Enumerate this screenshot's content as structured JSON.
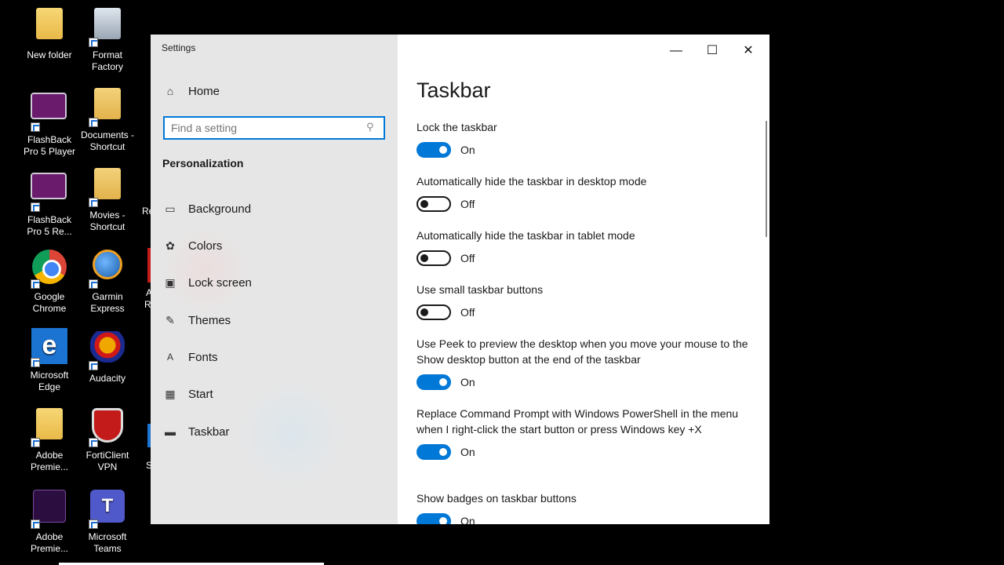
{
  "desktop": {
    "icons": [
      {
        "label1": "New folder",
        "label2": ""
      },
      {
        "label1": "Format",
        "label2": "Factory"
      },
      {
        "label1": "FlashBack",
        "label2": "Pro 5 Player"
      },
      {
        "label1": "Documents -",
        "label2": "Shortcut"
      },
      {
        "label1": "FlashBack",
        "label2": "Pro 5 Re..."
      },
      {
        "label1": "Movies -",
        "label2": "Shortcut"
      },
      {
        "label1": "Google",
        "label2": "Chrome"
      },
      {
        "label1": "Garmin",
        "label2": "Express"
      },
      {
        "label1": "Microsoft",
        "label2": "Edge"
      },
      {
        "label1": "Audacity",
        "label2": ""
      },
      {
        "label1": "Adobe",
        "label2": "Premie..."
      },
      {
        "label1": "FortiClient",
        "label2": "VPN"
      },
      {
        "label1": "Adobe",
        "label2": "Premie..."
      },
      {
        "label1": "Microsoft",
        "label2": "Teams"
      }
    ],
    "partial_labels": [
      "Re",
      "A",
      "R",
      "S"
    ]
  },
  "window": {
    "title": "Settings",
    "controls": {
      "minimize": "—",
      "maximize": "☐",
      "close": "✕"
    }
  },
  "nav": {
    "home": "Home",
    "search_placeholder": "Find a setting",
    "section": "Personalization",
    "items": [
      {
        "label": "Background",
        "icon": "picture-icon"
      },
      {
        "label": "Colors",
        "icon": "palette-icon"
      },
      {
        "label": "Lock screen",
        "icon": "monitor-icon"
      },
      {
        "label": "Themes",
        "icon": "brush-icon"
      },
      {
        "label": "Fonts",
        "icon": "font-icon"
      },
      {
        "label": "Start",
        "icon": "start-grid-icon"
      },
      {
        "label": "Taskbar",
        "icon": "taskbar-icon"
      }
    ]
  },
  "main": {
    "title": "Taskbar",
    "settings": [
      {
        "label": "Lock the taskbar",
        "state": "On",
        "on": true
      },
      {
        "label": "Automatically hide the taskbar in desktop mode",
        "state": "Off",
        "on": false
      },
      {
        "label": "Automatically hide the taskbar in tablet mode",
        "state": "Off",
        "on": false
      },
      {
        "label": "Use small taskbar buttons",
        "state": "Off",
        "on": false
      },
      {
        "label": "Use Peek to preview the desktop when you move your mouse to the Show desktop button at the end of the taskbar",
        "state": "On",
        "on": true
      },
      {
        "label": "Replace Command Prompt with Windows PowerShell in the menu when I right-click the start button or press Windows key +X",
        "state": "On",
        "on": true
      },
      {
        "label": "Show badges on taskbar buttons",
        "state": "On",
        "on": true
      }
    ]
  },
  "colors": {
    "accent": "#0078d7",
    "nav_bg": "#e6e6e6",
    "desktop_bg": "#000000"
  }
}
